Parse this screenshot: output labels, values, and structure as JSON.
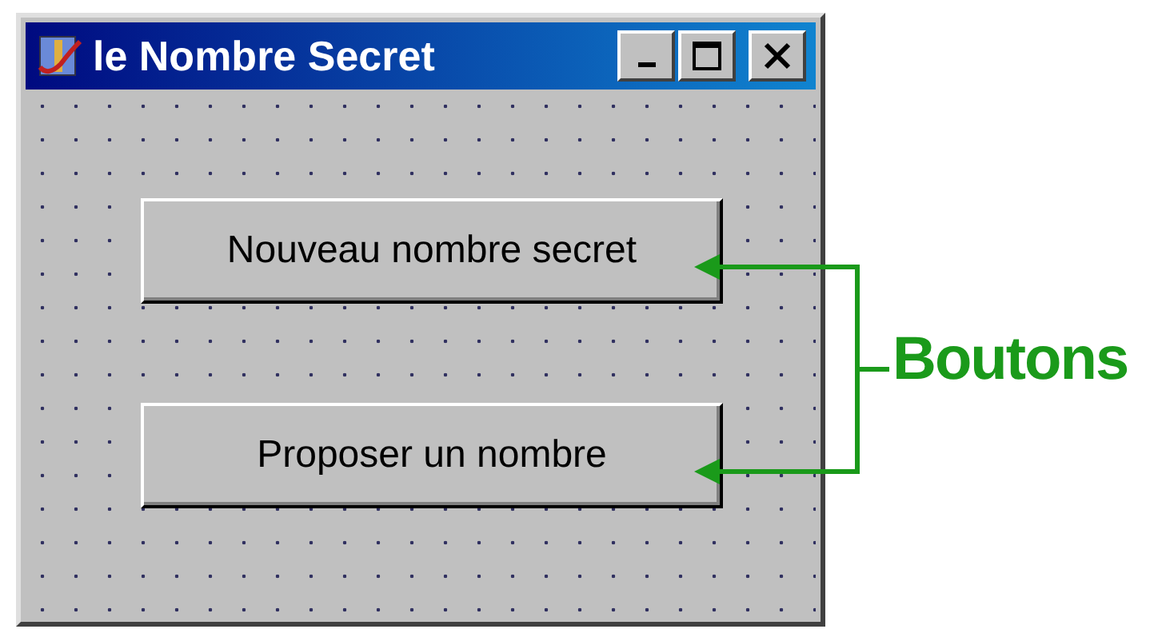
{
  "window": {
    "title": "le Nombre Secret"
  },
  "buttons": [
    {
      "label": "Nouveau nombre secret"
    },
    {
      "label": "Proposer un nombre"
    }
  ],
  "annotation": {
    "label": "Boutons"
  }
}
